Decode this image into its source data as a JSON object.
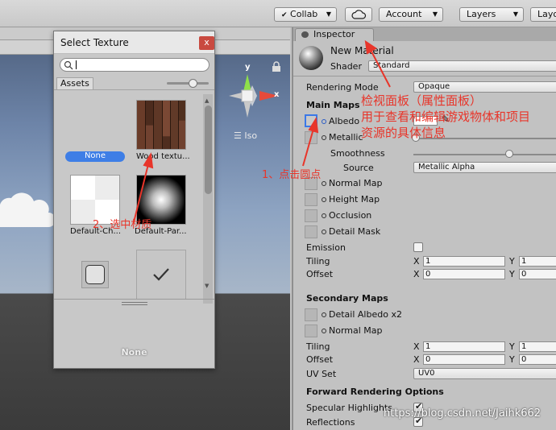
{
  "toolbar": {
    "collab": "Collab",
    "account": "Account",
    "layers": "Layers",
    "layout": "Layo"
  },
  "scene": {
    "gizmo_y": "y",
    "gizmo_x": "x",
    "iso": "Iso"
  },
  "picker": {
    "title": "Select Texture",
    "close": "x",
    "search_value": "",
    "tab_assets": "Assets",
    "items": [
      {
        "label": "None"
      },
      {
        "label": "Wood textu..."
      },
      {
        "label": "Default-Ch..."
      },
      {
        "label": "Default-Par..."
      }
    ],
    "footer_label": "None"
  },
  "inspector": {
    "tab": "Inspector",
    "material_name": "New Material",
    "shader_label": "Shader",
    "shader_value": "Standard",
    "rendering_mode_label": "Rendering Mode",
    "rendering_mode_value": "Opaque",
    "main_maps": "Main Maps",
    "albedo": "Albedo",
    "metallic": "Metallic",
    "smoothness": "Smoothness",
    "source_label": "Source",
    "source_value": "Metallic Alpha",
    "normal_map": "Normal Map",
    "height_map": "Height Map",
    "occlusion": "Occlusion",
    "detail_mask": "Detail Mask",
    "emission": "Emission",
    "tiling": "Tiling",
    "offset": "Offset",
    "x": "X",
    "y": "Y",
    "tiling_x": "1",
    "tiling_y": "1",
    "offset_x": "0",
    "offset_y": "0",
    "secondary_maps": "Secondary Maps",
    "detail_albedo": "Detail Albedo x2",
    "normal_map2": "Normal Map",
    "tiling2_x": "1",
    "tiling2_y": "1",
    "offset2_x": "0",
    "offset2_y": "0",
    "uv_set_label": "UV Set",
    "uv_set_value": "UV0",
    "forward_options": "Forward Rendering Options",
    "specular_highlights": "Specular Highlights",
    "reflections": "Reflections",
    "smoothness_value": 0.7
  },
  "annotations": {
    "inspector_note_1": "检视面板（属性面板）",
    "inspector_note_2": "用于查看和编辑游戏物体和项目",
    "inspector_note_3": "资源的具体信息",
    "step1": "1、点击圆点",
    "step2": "2、选中材质",
    "watermark": "https://blog.csdn.net/Jaihk662"
  },
  "colors": {
    "annotation": "#e8352a",
    "selection": "#3b78e7"
  }
}
